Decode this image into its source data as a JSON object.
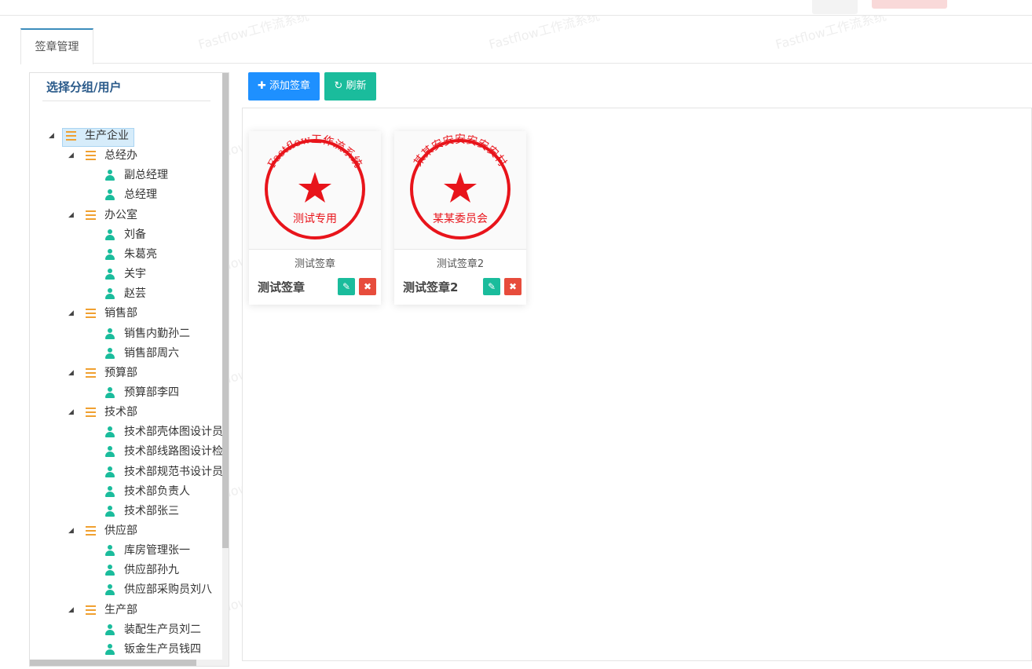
{
  "tabs": [
    "签章管理"
  ],
  "left": {
    "title": "选择分组/用户",
    "tree": [
      {
        "label": "生产企业",
        "type": "group",
        "level": 0,
        "selected": true
      },
      {
        "label": "总经办",
        "type": "group",
        "level": 1
      },
      {
        "label": "副总经理",
        "type": "user",
        "level": 2
      },
      {
        "label": "总经理",
        "type": "user",
        "level": 2
      },
      {
        "label": "办公室",
        "type": "group",
        "level": 1
      },
      {
        "label": "刘备",
        "type": "user",
        "level": 2
      },
      {
        "label": "朱葛亮",
        "type": "user",
        "level": 2
      },
      {
        "label": "关宇",
        "type": "user",
        "level": 2
      },
      {
        "label": "赵芸",
        "type": "user",
        "level": 2
      },
      {
        "label": "销售部",
        "type": "group",
        "level": 1
      },
      {
        "label": "销售内勤孙二",
        "type": "user",
        "level": 2
      },
      {
        "label": "销售部周六",
        "type": "user",
        "level": 2
      },
      {
        "label": "预算部",
        "type": "group",
        "level": 1
      },
      {
        "label": "预算部李四",
        "type": "user",
        "level": 2
      },
      {
        "label": "技术部",
        "type": "group",
        "level": 1
      },
      {
        "label": "技术部壳体图设计员",
        "type": "user",
        "level": 2
      },
      {
        "label": "技术部线路图设计检",
        "type": "user",
        "level": 2
      },
      {
        "label": "技术部规范书设计员",
        "type": "user",
        "level": 2
      },
      {
        "label": "技术部负责人",
        "type": "user",
        "level": 2
      },
      {
        "label": "技术部张三",
        "type": "user",
        "level": 2
      },
      {
        "label": "供应部",
        "type": "group",
        "level": 1
      },
      {
        "label": "库房管理张一",
        "type": "user",
        "level": 2
      },
      {
        "label": "供应部孙九",
        "type": "user",
        "level": 2
      },
      {
        "label": "供应部采购员刘八",
        "type": "user",
        "level": 2
      },
      {
        "label": "生产部",
        "type": "group",
        "level": 1
      },
      {
        "label": "装配生产员刘二",
        "type": "user",
        "level": 2
      },
      {
        "label": "钣金生产员钱四",
        "type": "user",
        "level": 2
      }
    ]
  },
  "toolbar": {
    "add_label": "添加签章",
    "refresh_label": "刷新"
  },
  "seals": [
    {
      "caption": "测试签章",
      "title": "测试签章",
      "ring_text": "Fastflow工作流系统",
      "bottom_text": "测试专用"
    },
    {
      "caption": "测试签章2",
      "title": "测试签章2",
      "ring_text": "某某安安安安安安村",
      "bottom_text": "某某委员会"
    }
  ],
  "watermark": "Fastflow工作流系统",
  "colors": {
    "primary": "#1e90ff",
    "success": "#1abc9c",
    "danger": "#e74c3c",
    "seal_red": "#e8141b",
    "group_icon": "#f0a030"
  }
}
